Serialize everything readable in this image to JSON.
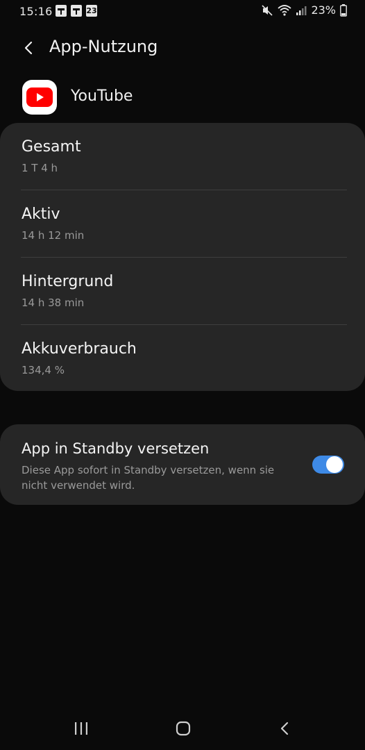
{
  "status_bar": {
    "time": "15:16",
    "calendar_day": "23",
    "battery": "23%"
  },
  "header": {
    "title": "App-Nutzung"
  },
  "app": {
    "name": "YouTube",
    "icon": "youtube-icon"
  },
  "usage": {
    "items": [
      {
        "label": "Gesamt",
        "value": "1 T 4 h"
      },
      {
        "label": "Aktiv",
        "value": "14 h 12 min"
      },
      {
        "label": "Hintergrund",
        "value": "14 h 38 min"
      },
      {
        "label": "Akkuverbrauch",
        "value": "134,4 %"
      }
    ]
  },
  "standby": {
    "title": "App in Standby versetzen",
    "description": "Diese App sofort in Standby versetzen, wenn sie nicht verwendet wird.",
    "enabled": true
  },
  "colors": {
    "background": "#0a0a0a",
    "card": "#262626",
    "accent": "#3e8ae6",
    "youtube_red": "#ff0000"
  }
}
